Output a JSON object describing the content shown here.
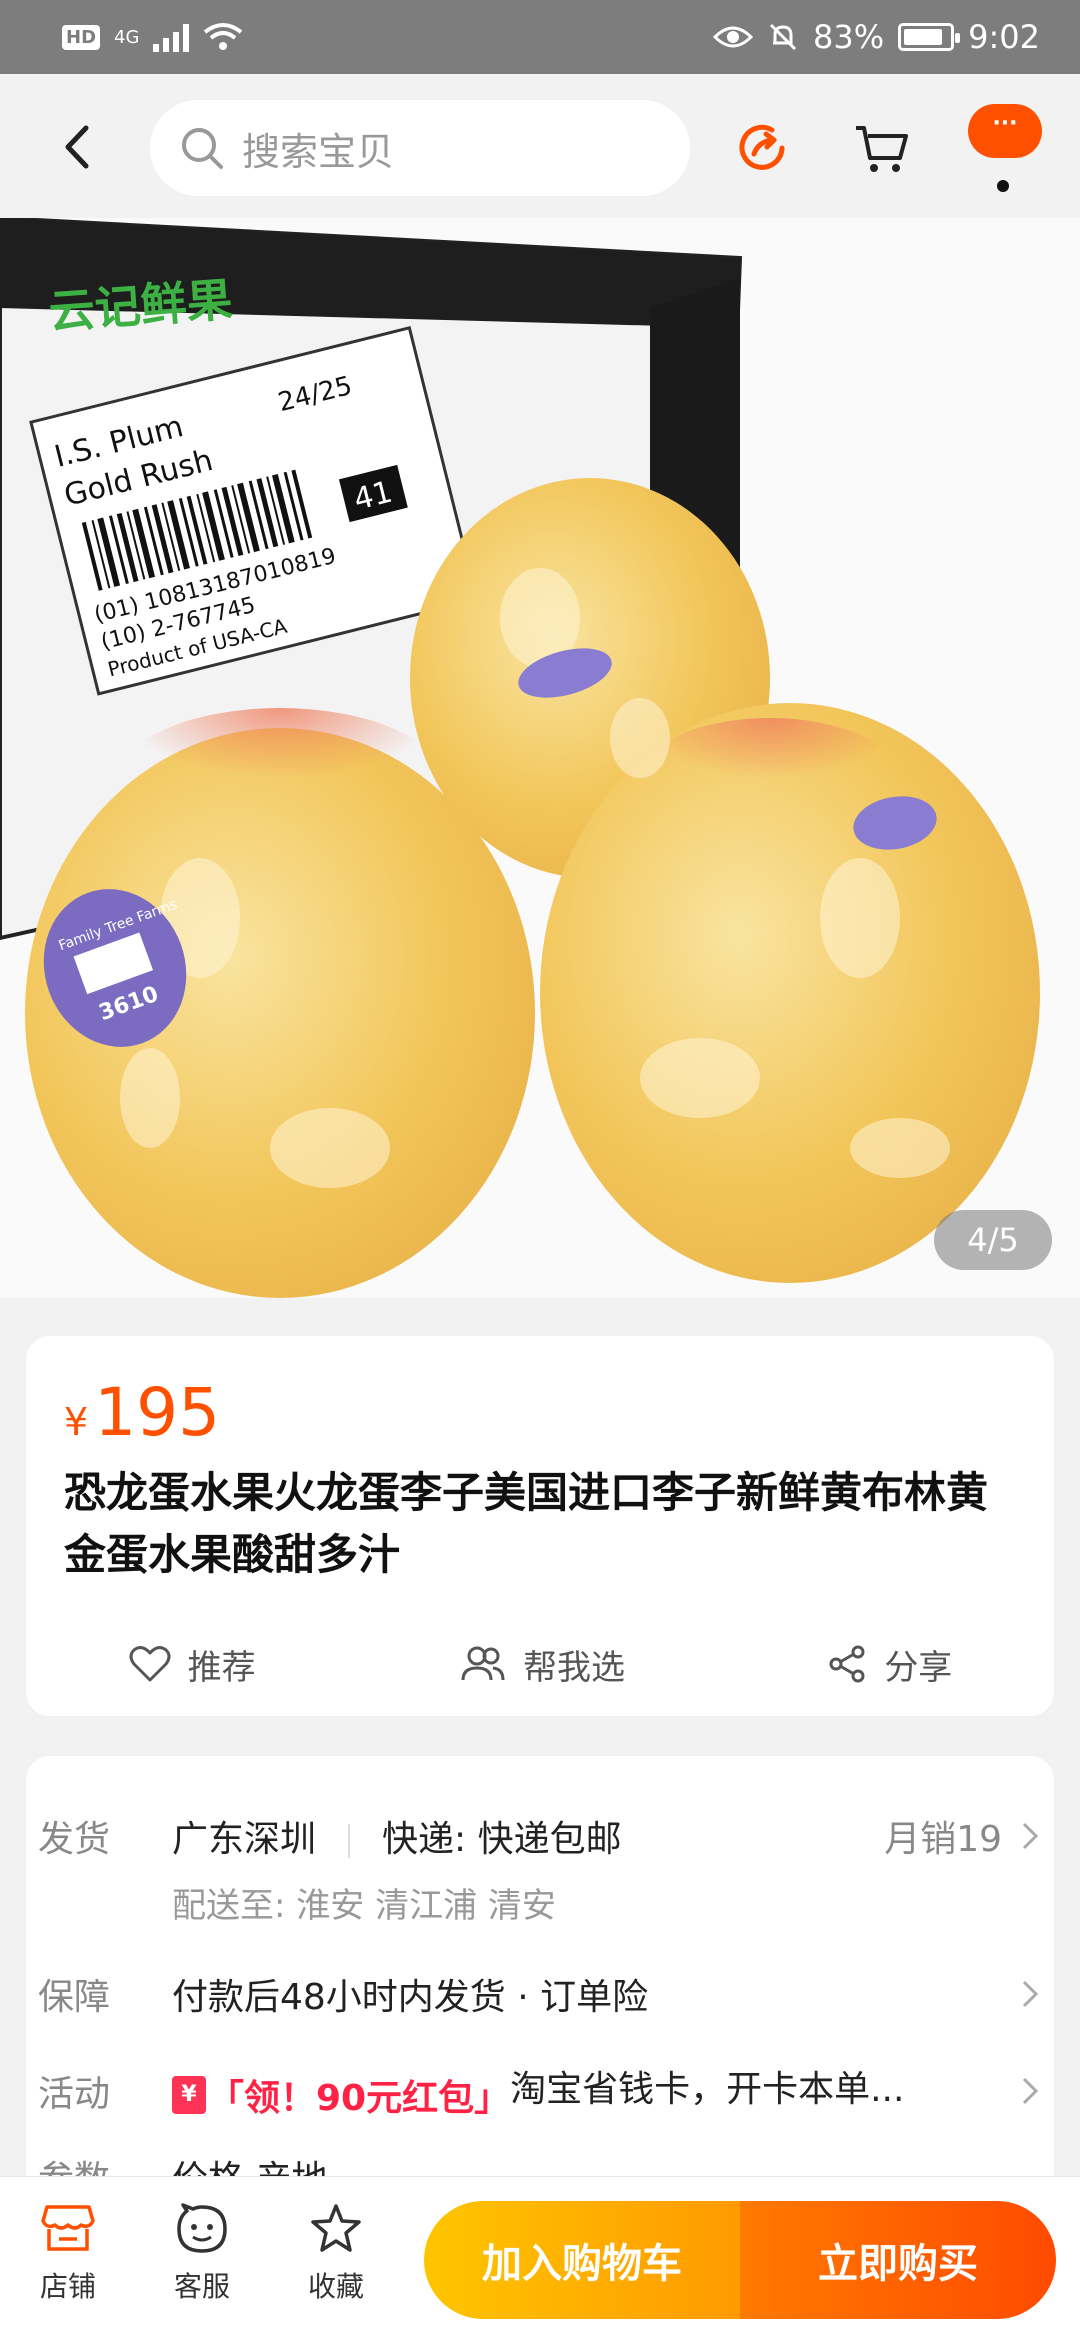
{
  "status_bar": {
    "network": "4G",
    "hd": "HD",
    "battery": "83%",
    "time": "9:02"
  },
  "header": {
    "search_placeholder": "搜索宝贝",
    "more_label": "···"
  },
  "gallery": {
    "pager": "4/5",
    "image_texts": {
      "brand": "云记鲜果",
      "box_label_1": "I.S. Plum",
      "box_label_2": "Gold Rush",
      "box_size": "24/25",
      "barcode_1": "(01) 10813187010819",
      "barcode_2": "(10) 2-767745",
      "origin": "Product of USA-CA",
      "lot": "41",
      "sticker_brand": "Family Tree Farms",
      "sticker_code": "3610"
    }
  },
  "product": {
    "currency": "¥",
    "price": "195",
    "title": "恐龙蛋水果火龙蛋李子美国进口李子新鲜黄布林黄金蛋水果酸甜多汁",
    "actions": {
      "recommend": "推荐",
      "help_choose": "帮我选",
      "share": "分享"
    }
  },
  "info": {
    "ship_label": "发货",
    "ship_from": "广东深圳",
    "delivery": "快递: 快递包邮",
    "monthly_sales": "月销19",
    "deliver_to": "配送至: 淮安 清江浦 清安",
    "guarantee_label": "保障",
    "guarantee": "付款后48小时内发货 · 订单险",
    "promo_label": "活动",
    "promo_icon": "¥",
    "promo_tag": "「领！90元红包」",
    "promo_text": "淘宝省钱卡，开卡本单...",
    "params_label": "参数",
    "params": "价格 产地"
  },
  "bottom_bar": {
    "shop": "店铺",
    "service": "客服",
    "favorite": "收藏",
    "add_to_cart": "加入购物车",
    "buy_now": "立即购买"
  },
  "colors": {
    "accent": "#ff5000",
    "cart_button": "#ffb300",
    "buy_button": "#ff5a00",
    "promo_red": "#ff2244"
  }
}
